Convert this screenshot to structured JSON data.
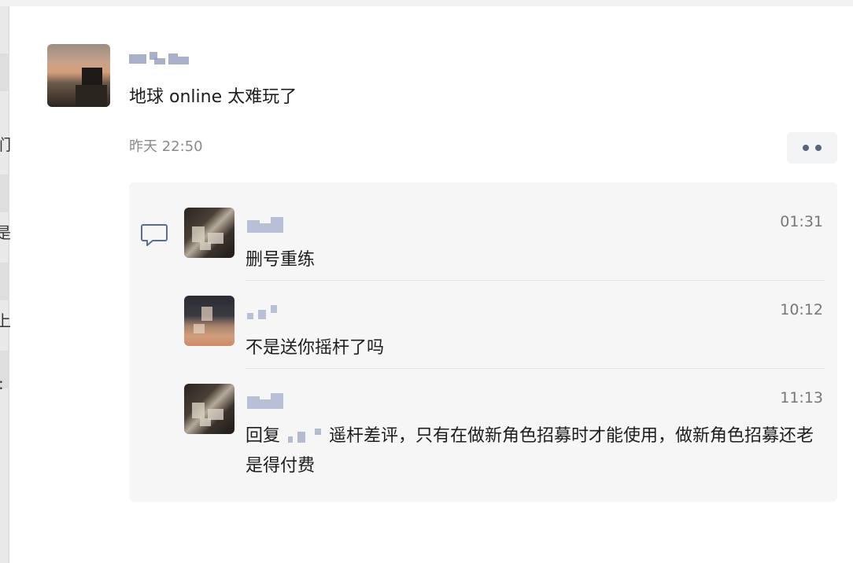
{
  "post": {
    "text": "地球 online 太难玩了",
    "time": "昨天 22:50",
    "more_icon": "more-dots-icon"
  },
  "replies": [
    {
      "time": "01:31",
      "text": "删号重练"
    },
    {
      "time": "10:12",
      "text": "不是送你摇杆了吗"
    },
    {
      "time": "11:13",
      "prefix": "回复",
      "text": "遥杆差评，只有在做新角色招募时才能使用，做新角色招募还老是得付费"
    }
  ],
  "left_edge_glyphs": [
    "们",
    "是",
    "上",
    ":"
  ],
  "colors": {
    "panel_bg": "#f6f6f6",
    "time_gray": "#8a8a8a",
    "dots": "#596579"
  },
  "icons": {
    "comment": "comment-bubble-icon"
  }
}
